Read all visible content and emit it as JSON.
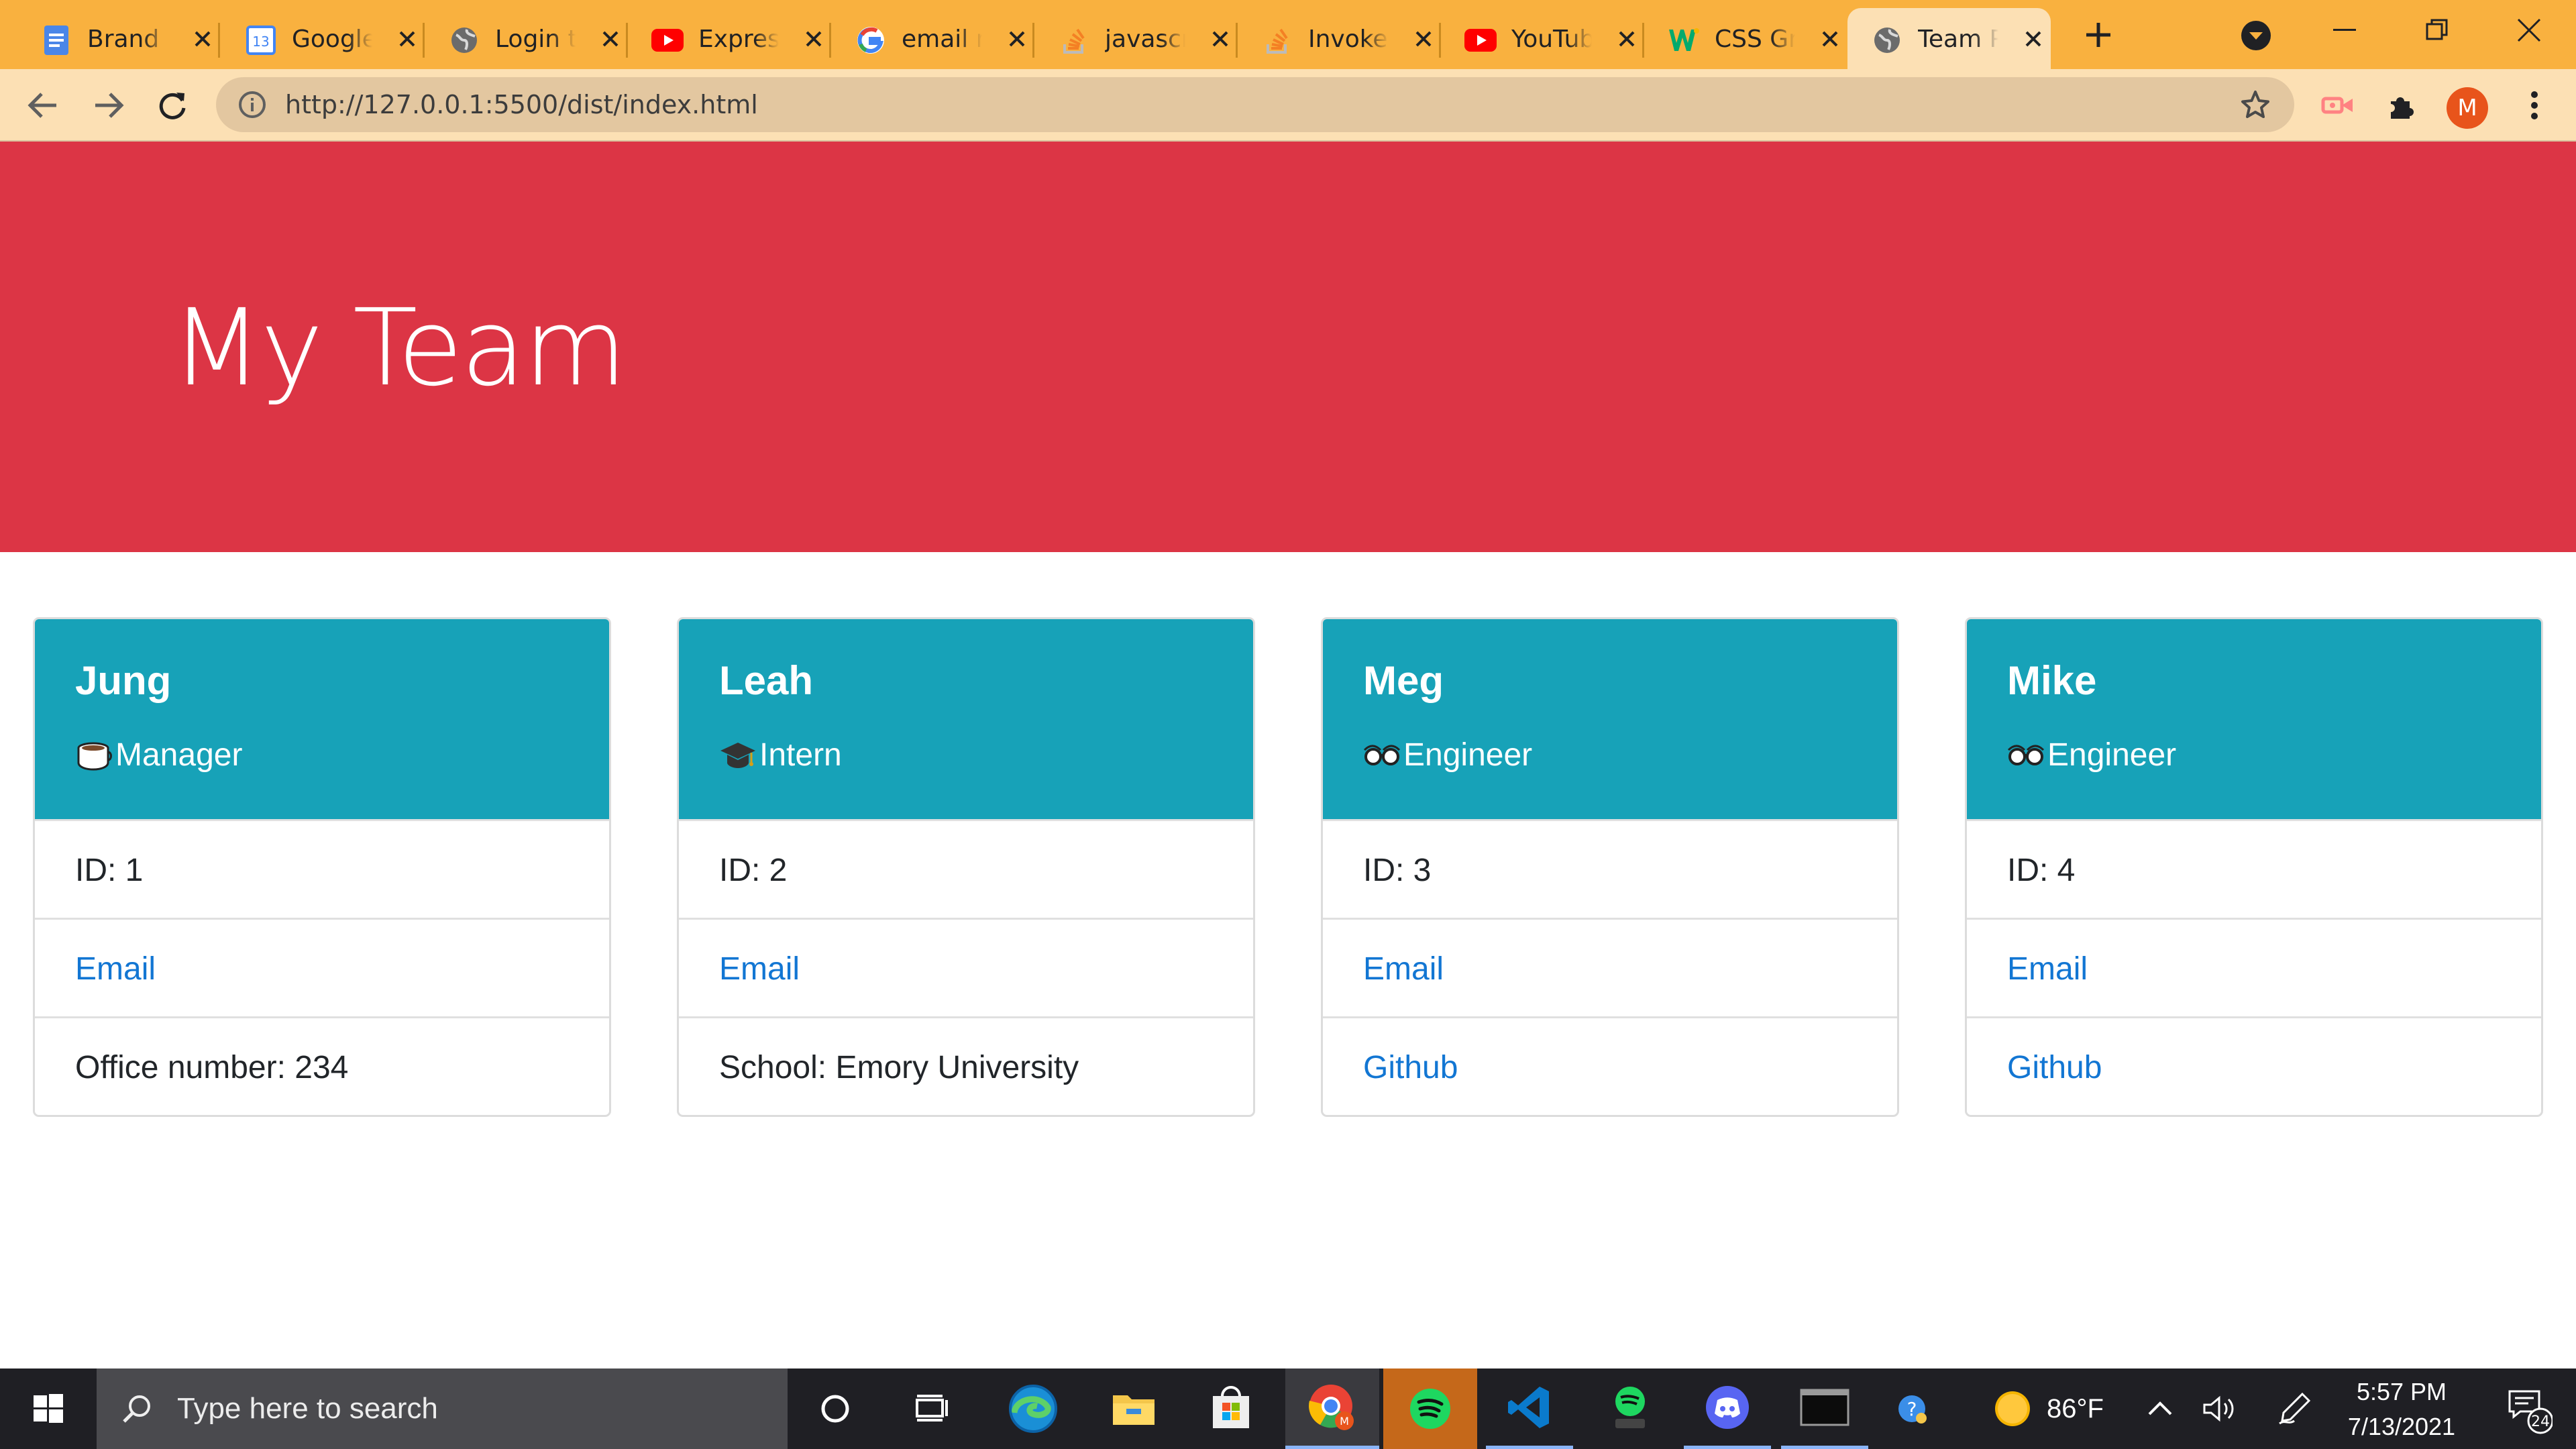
{
  "browser": {
    "tabs": [
      {
        "title": "Brand S",
        "icon": "google-docs-icon",
        "active": false
      },
      {
        "title": "Google",
        "icon": "google-calendar-icon",
        "active": false
      },
      {
        "title": "Login t",
        "icon": "globe-icon",
        "active": false
      },
      {
        "title": "Express",
        "icon": "youtube-icon",
        "active": false
      },
      {
        "title": "email n",
        "icon": "google-icon",
        "active": false
      },
      {
        "title": "javascr",
        "icon": "stackoverflow-icon",
        "active": false
      },
      {
        "title": "Invoke",
        "icon": "stackoverflow-icon",
        "active": false
      },
      {
        "title": "YouTub",
        "icon": "youtube-icon",
        "active": false
      },
      {
        "title": "CSS Gr",
        "icon": "w3schools-icon",
        "active": false
      },
      {
        "title": "Team P",
        "icon": "globe-icon",
        "active": true
      }
    ],
    "url": "http://127.0.0.1:5500/dist/index.html",
    "profile_initial": "M",
    "calendar_day": "13",
    "colors": {
      "tabstrip": "#f9b13f",
      "toolbar": "#fce0b4",
      "omnibox": "#e3c7a0"
    }
  },
  "page": {
    "title": "My Team",
    "colors": {
      "header": "#dc3545",
      "card_header": "#17a2b8",
      "link": "#1276d3"
    },
    "cards": [
      {
        "name": "Jung",
        "role": "Manager",
        "role_icon": "coffee-mug-icon",
        "rows": [
          {
            "text": "ID: 1",
            "link": false
          },
          {
            "text": "Email",
            "link": true
          },
          {
            "text": "Office number: 234",
            "link": false
          }
        ]
      },
      {
        "name": "Leah",
        "role": "Intern",
        "role_icon": "graduation-cap-icon",
        "rows": [
          {
            "text": "ID: 2",
            "link": false
          },
          {
            "text": "Email",
            "link": true
          },
          {
            "text": "School: Emory University",
            "link": false
          }
        ]
      },
      {
        "name": "Meg",
        "role": "Engineer",
        "role_icon": "glasses-icon",
        "rows": [
          {
            "text": "ID: 3",
            "link": false
          },
          {
            "text": "Email",
            "link": true
          },
          {
            "text": "Github",
            "link": true
          }
        ]
      },
      {
        "name": "Mike",
        "role": "Engineer",
        "role_icon": "glasses-icon",
        "rows": [
          {
            "text": "ID: 4",
            "link": false
          },
          {
            "text": "Email",
            "link": true
          },
          {
            "text": "Github",
            "link": true
          }
        ]
      }
    ]
  },
  "taskbar": {
    "search_placeholder": "Type here to search",
    "weather_temp": "86°F",
    "time": "5:57 PM",
    "date": "7/13/2021",
    "notification_count": "24"
  }
}
